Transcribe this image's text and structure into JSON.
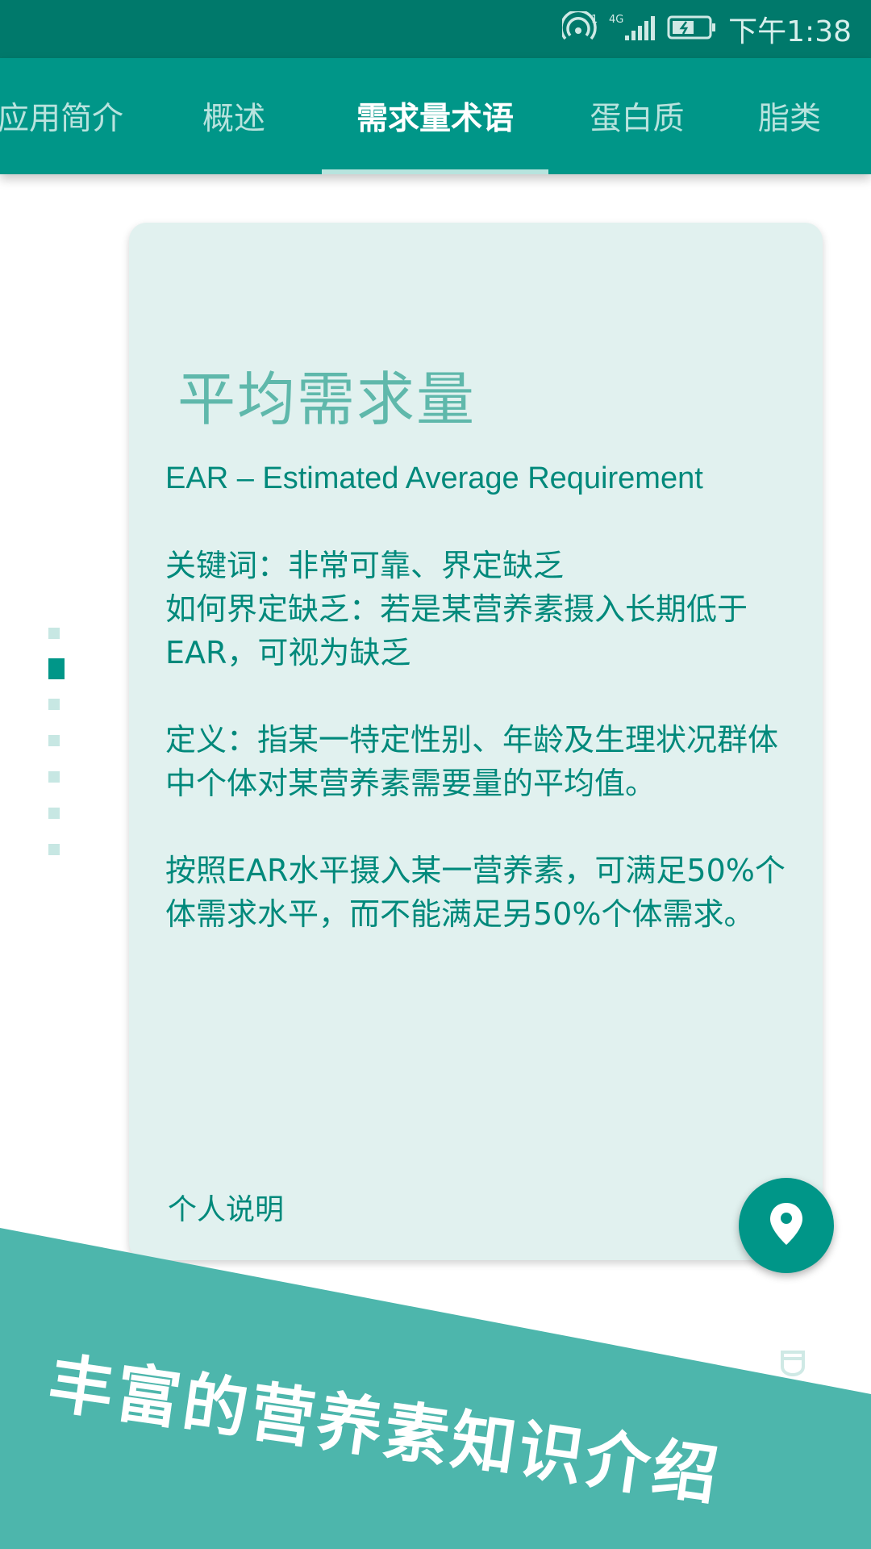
{
  "status_bar": {
    "time": "下午1:38",
    "network": "4G",
    "sim": "1",
    "icons": [
      "hotspot-icon",
      "signal-icon",
      "battery-icon"
    ]
  },
  "tabs": [
    {
      "label": "应用简介",
      "active": false
    },
    {
      "label": "概述",
      "active": false
    },
    {
      "label": "需求量术语",
      "active": true
    },
    {
      "label": "蛋白质",
      "active": false
    },
    {
      "label": "脂类",
      "active": false
    }
  ],
  "page_indicator": {
    "count": 7,
    "active_index": 1
  },
  "card": {
    "title": "平均需求量",
    "subtitle": "EAR – Estimated Average Requirement",
    "paragraphs": [
      "关键词：非常可靠、界定缺乏\n如何界定缺乏：若是某营养素摄入长期低于EAR，可视为缺乏",
      "定义：指某一特定性别、年龄及生理状况群体中个体对某营养素需要量的平均值。",
      "按照EAR水平摄入某一营养素，可满足50%个体需求水平，而不能满足另50%个体需求。"
    ],
    "footer": "个人说明"
  },
  "fab": {
    "icon": "location-pin-icon"
  },
  "promo": {
    "text": "丰富的营养素知识介绍",
    "color": "#4db6ac"
  },
  "colors": {
    "status_bar": "#00796b",
    "primary": "#009688",
    "card_bg": "#e1f1ef",
    "title": "#5fb8ab",
    "body_text": "#00897b"
  }
}
